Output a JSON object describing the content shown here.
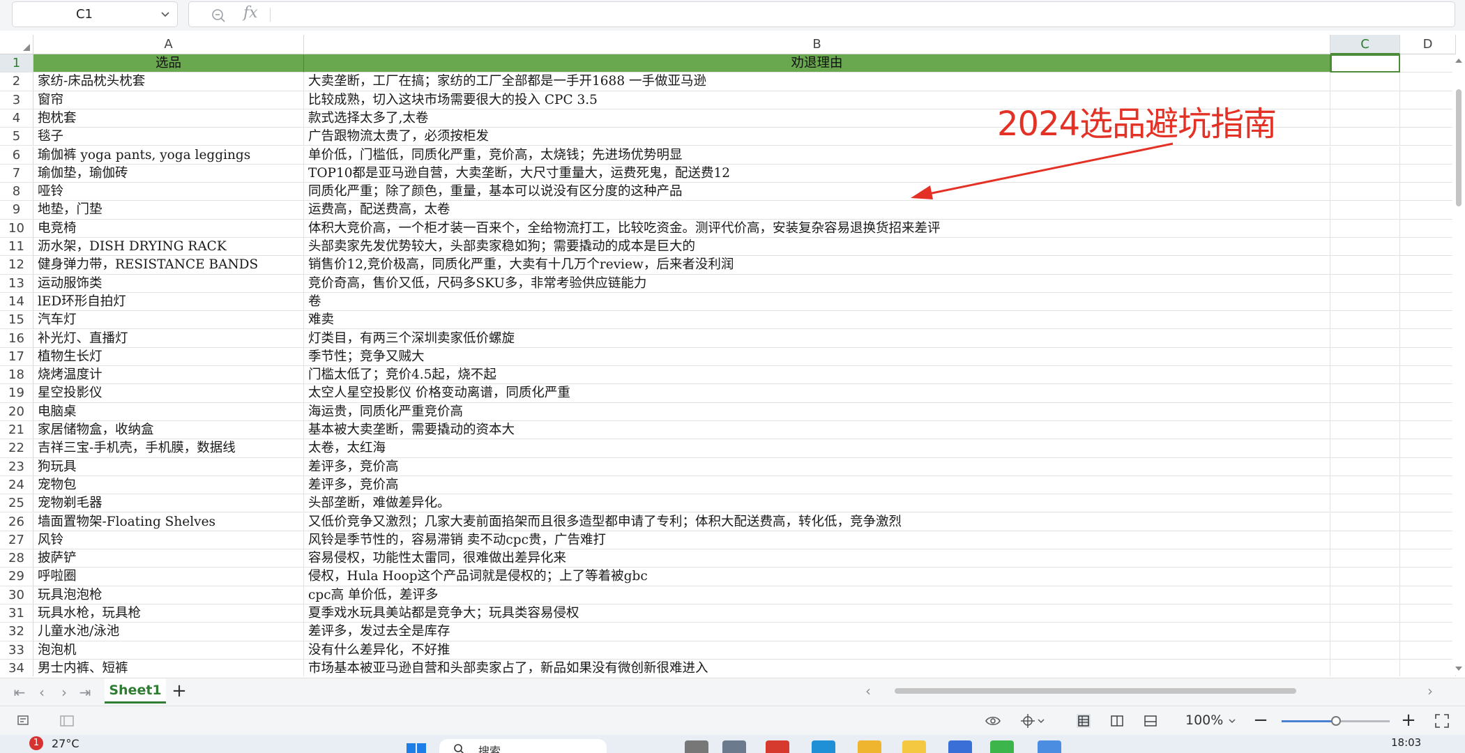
{
  "formula_bar": {
    "name_box": "C1",
    "fx_label": "fx",
    "content": ""
  },
  "columns": [
    "A",
    "B",
    "C",
    "D"
  ],
  "selected_column": "C",
  "header_row": {
    "a": "选品",
    "b": "劝退理由"
  },
  "rows": [
    {
      "n": "2",
      "a": "家纺-床品枕头枕套",
      "b": "大卖垄断，工厂在搞；家纺的工厂全部都是一手开1688 一手做亚马逊"
    },
    {
      "n": "3",
      "a": "窗帘",
      "b": "比较成熟，切入这块市场需要很大的投入 CPC 3.5"
    },
    {
      "n": "4",
      "a": "抱枕套",
      "b": "款式选择太多了,太卷"
    },
    {
      "n": "5",
      "a": "毯子",
      "b": "广告跟物流太贵了，必须按柜发"
    },
    {
      "n": "6",
      "a": "瑜伽裤 yoga pants, yoga leggings",
      "b": "单价低，门槛低，同质化严重，竞价高，太烧钱；先进场优势明显"
    },
    {
      "n": "7",
      "a": "瑜伽垫，瑜伽砖",
      "b": "TOP10都是亚马逊自营，大卖垄断，大尺寸重量大，运费死鬼，配送费12"
    },
    {
      "n": "8",
      "a": "哑铃",
      "b": "同质化严重；除了颜色，重量，基本可以说没有区分度的这种产品"
    },
    {
      "n": "9",
      "a": "地垫，门垫",
      "b": "运费高，配送费高，太卷"
    },
    {
      "n": "10",
      "a": "电竞椅",
      "b": "体积大竞价高，一个柜才装一百来个，全给物流打工，比较吃资金。测评代价高，安装复杂容易退换货招来差评"
    },
    {
      "n": "11",
      "a": "沥水架，DISH DRYING RACK",
      "b": "头部卖家先发优势较大，头部卖家稳如狗；需要撬动的成本是巨大的"
    },
    {
      "n": "12",
      "a": "健身弹力带，RESISTANCE BANDS",
      "b": "销售价12,竞价极高，同质化严重，大卖有十几万个review，后来者没利润"
    },
    {
      "n": "13",
      "a": "运动服饰类",
      "b": "竞价奇高，售价又低，尺码多SKU多，非常考验供应链能力"
    },
    {
      "n": "14",
      "a": "lED环形自拍灯",
      "b": "卷"
    },
    {
      "n": "15",
      "a": "汽车灯",
      "b": "难卖"
    },
    {
      "n": "16",
      "a": "补光灯、直播灯",
      "b": "灯类目，有两三个深圳卖家低价螺旋"
    },
    {
      "n": "17",
      "a": "植物生长灯",
      "b": "季节性；竞争又贼大"
    },
    {
      "n": "18",
      "a": "烧烤温度计",
      "b": "门槛太低了；竞价4.5起，烧不起"
    },
    {
      "n": "19",
      "a": "星空投影仪",
      "b": "太空人星空投影仪 价格变动离谱，同质化严重"
    },
    {
      "n": "20",
      "a": "电脑桌",
      "b": "海运贵，同质化严重竞价高"
    },
    {
      "n": "21",
      "a": "家居储物盒，收纳盒",
      "b": "基本被大卖垄断，需要撬动的资本大"
    },
    {
      "n": "22",
      "a": "吉祥三宝-手机壳，手机膜，数据线",
      "b": "太卷，太红海"
    },
    {
      "n": "23",
      "a": "狗玩具",
      "b": "差评多，竞价高"
    },
    {
      "n": "24",
      "a": "宠物包",
      "b": "差评多，竞价高"
    },
    {
      "n": "25",
      "a": "宠物剃毛器",
      "b": "头部垄断，难做差异化。"
    },
    {
      "n": "26",
      "a": "墙面置物架-Floating Shelves",
      "b": "又低价竞争又激烈；几家大麦前面掐架而且很多造型都申请了专利；体积大配送费高，转化低，竞争激烈"
    },
    {
      "n": "27",
      "a": "风铃",
      "b": "风铃是季节性的，容易滞销   卖不动cpc贵，广告难打"
    },
    {
      "n": "28",
      "a": "披萨铲",
      "b": "容易侵权，功能性太雷同，很难做出差异化来"
    },
    {
      "n": "29",
      "a": "呼啦圈",
      "b": "侵权，Hula Hoop这个产品词就是侵权的；上了等着被gbc"
    },
    {
      "n": "30",
      "a": "玩具泡泡枪",
      "b": "  cpc高 单价低，差评多"
    },
    {
      "n": "31",
      "a": "玩具水枪，玩具枪",
      "b": "夏季戏水玩具美站都是竞争大；玩具类容易侵权"
    },
    {
      "n": "32",
      "a": "儿童水池/泳池",
      "b": "差评多，发过去全是库存"
    },
    {
      "n": "33",
      "a": "泡泡机",
      "b": "没有什么差异化，不好推"
    },
    {
      "n": "34",
      "a": "男士内裤、短裤",
      "b": "市场基本被亚马逊自营和头部卖家占了，新品如果没有微创新很难进入"
    }
  ],
  "annotation": {
    "text": "2024选品避坑指南",
    "color": "#e43126"
  },
  "sheets": {
    "active": "Sheet1",
    "add_label": "+"
  },
  "status": {
    "zoom": "100%",
    "zoom_fraction": 0.5,
    "minus": "−",
    "plus": "+"
  },
  "taskbar": {
    "weather_badge": "1",
    "temperature": "27°C",
    "search_placeholder": "搜索",
    "time": "18:03"
  },
  "colors": {
    "header_fill": "#6aa84f",
    "accent": "#2e7d32"
  }
}
